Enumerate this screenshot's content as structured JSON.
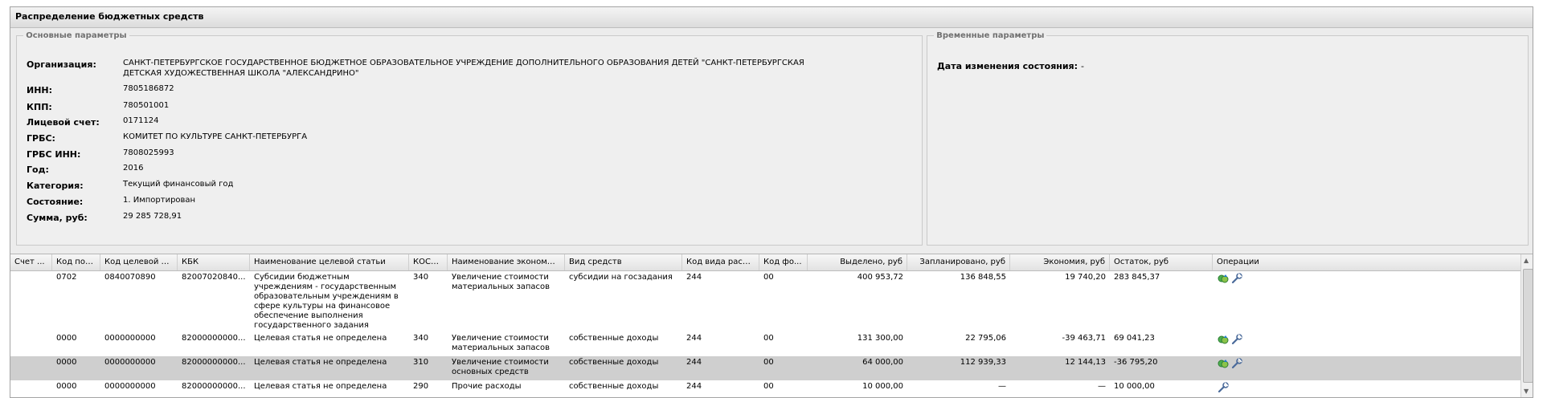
{
  "panel": {
    "title": "Распределение бюджетных средств"
  },
  "main_params": {
    "legend": "Основные параметры",
    "fields": [
      {
        "label": "Организация:",
        "value": "САНКТ-ПЕТЕРБУРГСКОЕ ГОСУДАРСТВЕННОЕ БЮДЖЕТНОЕ ОБРАЗОВАТЕЛЬНОЕ УЧРЕЖДЕНИЕ ДОПОЛНИТЕЛЬНОГО ОБРАЗОВАНИЯ ДЕТЕЙ \"САНКТ-ПЕТЕРБУРГСКАЯ ДЕТСКАЯ ХУДОЖЕСТВЕННАЯ ШКОЛА \"АЛЕКСАНДРИНО\""
      },
      {
        "label": "ИНН:",
        "value": "7805186872"
      },
      {
        "label": "КПП:",
        "value": "780501001"
      },
      {
        "label": "Лицевой счет:",
        "value": "0171124"
      },
      {
        "label": "ГРБС:",
        "value": "КОМИТЕТ ПО КУЛЬТУРЕ САНКТ-ПЕТЕРБУРГА"
      },
      {
        "label": "ГРБС ИНН:",
        "value": "7808025993"
      },
      {
        "label": "Год:",
        "value": "2016"
      },
      {
        "label": "Категория:",
        "value": "Текущий финансовый год"
      },
      {
        "label": "Состояние:",
        "value": "1. Импортирован"
      },
      {
        "label": "Сумма, руб:",
        "value": "29 285 728,91"
      }
    ]
  },
  "time_params": {
    "legend": "Временные параметры",
    "label": "Дата изменения состояния:",
    "value": "-"
  },
  "grid": {
    "columns": [
      "Счет ...",
      "Код под...",
      "Код целевой ст...",
      "КБК",
      "Наименование целевой статьи",
      "КОСГ...",
      "Наименование экономич...",
      "Вид средств",
      "Код вида расхо...",
      "Код фо...",
      "Выделено, руб",
      "Запланировано, руб",
      "Экономия, руб",
      "Остаток, руб",
      "Операции"
    ],
    "rows": [
      {
        "cells": [
          "",
          "0702",
          "0840070890",
          "82007020840...",
          "Субсидии бюджетным учреждениям - государственным образовательным учреждениям в сфере культуры на финансовое обеспечение выполнения государственного задания",
          "340",
          "Увеличение стоимости материальных запасов",
          "субсидии на госзадания",
          "244",
          "00",
          "400 953,72",
          "136 848,55",
          "19 740,20",
          "283 845,37"
        ],
        "ops": [
          "money-icon",
          "wrench-icon"
        ]
      },
      {
        "cells": [
          "",
          "0000",
          "0000000000",
          "82000000000...",
          "Целевая статья не определена",
          "340",
          "Увеличение стоимости материальных запасов",
          "собственные доходы",
          "244",
          "00",
          "131 300,00",
          "22 795,06",
          "-39 463,71",
          "69 041,23"
        ],
        "ops": [
          "money-icon",
          "wrench-icon"
        ]
      },
      {
        "cells": [
          "",
          "0000",
          "0000000000",
          "82000000000...",
          "Целевая статья не определена",
          "310",
          "Увеличение стоимости основных средств",
          "собственные доходы",
          "244",
          "00",
          "64 000,00",
          "112 939,33",
          "12 144,13",
          "-36 795,20"
        ],
        "ops": [
          "money-icon",
          "wrench-icon"
        ],
        "selected": true
      },
      {
        "cells": [
          "",
          "0000",
          "0000000000",
          "82000000000...",
          "Целевая статья не определена",
          "290",
          "Прочие расходы",
          "собственные доходы",
          "244",
          "00",
          "10 000,00",
          "—",
          "—",
          "10 000,00"
        ],
        "ops": [
          "wrench-icon"
        ]
      }
    ]
  }
}
